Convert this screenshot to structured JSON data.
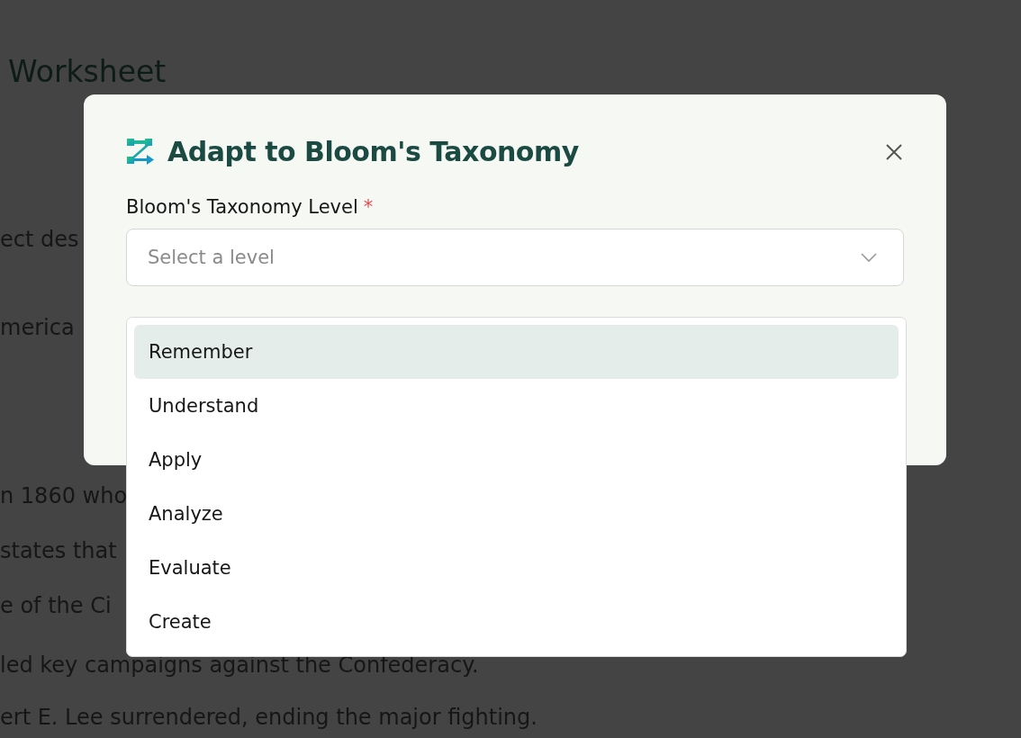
{
  "background_page": {
    "title": "Worksheet",
    "lines": [
      "ect des",
      "merica",
      "n 1860 who",
      "states that",
      "e of the Ci",
      "led key campaigns against the Confederacy.",
      "ert E. Lee surrendered, ending the major fighting."
    ]
  },
  "dialog": {
    "title": "Adapt to Bloom's Taxonomy",
    "field_label": "Bloom's Taxonomy Level",
    "required_mark": "*",
    "select": {
      "placeholder": "Select a level",
      "expanded": true
    },
    "options": [
      {
        "label": "Remember",
        "selected": true
      },
      {
        "label": "Understand",
        "selected": false
      },
      {
        "label": "Apply",
        "selected": false
      },
      {
        "label": "Analyze",
        "selected": false
      },
      {
        "label": "Evaluate",
        "selected": false
      },
      {
        "label": "Create",
        "selected": false
      }
    ]
  }
}
